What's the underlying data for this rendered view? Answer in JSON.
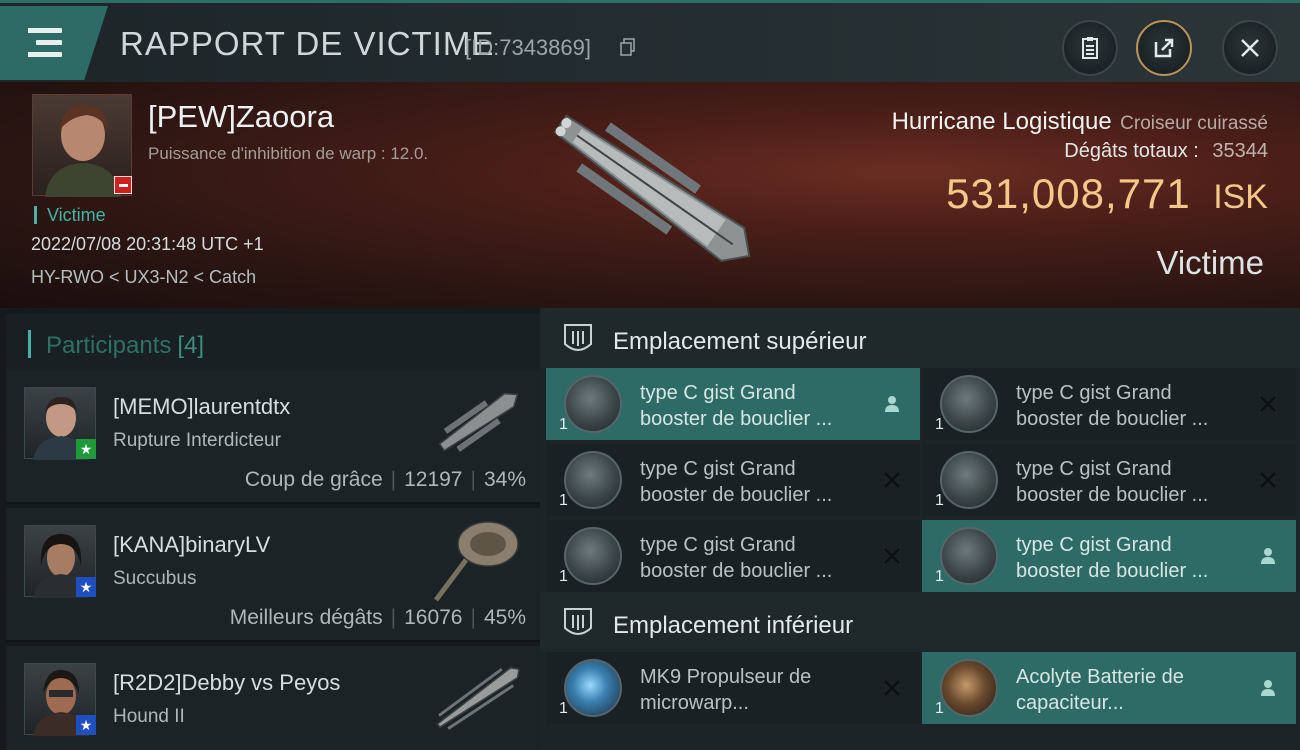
{
  "header": {
    "title": "RAPPORT DE VICTIME",
    "report_id": "[ID:7343869]"
  },
  "victim": {
    "pilot_name": "[PEW]Zaoora",
    "subtitle": "Puissance d'inhibition de warp : 12.0.",
    "tag": "Victime",
    "timestamp": "2022/07/08 20:31:48 UTC +1",
    "location": "HY-RWO < UX3-N2 < Catch",
    "ship_name": "Hurricane Logistique",
    "ship_class": "Croiseur cuirassé",
    "damage_label": "Dégâts totaux :",
    "damage_value": "35344",
    "isk_value": "531,008,771",
    "isk_unit": "ISK",
    "status_label": "Victime"
  },
  "participants": {
    "title": "Participants",
    "count": "[4]",
    "items": [
      {
        "name": "[MEMO]laurentdtx",
        "ship": "Rupture Interdicteur",
        "role": "Coup de grâce",
        "damage": "12197",
        "percent": "34%",
        "badge_color": "#1f9a3a",
        "badge_icon": "star-icon"
      },
      {
        "name": "[KANA]binaryLV",
        "ship": "Succubus",
        "role": "Meilleurs dégâts",
        "damage": "16076",
        "percent": "45%",
        "badge_color": "#1f4fbf",
        "badge_icon": "star-icon"
      },
      {
        "name": "[R2D2]Debby vs Peyos",
        "ship": "Hound II",
        "badge_color": "#1f4fbf",
        "badge_icon": "star-icon"
      }
    ]
  },
  "fittings": {
    "high_slot_title": "Emplacement supérieur",
    "low_slot_title": "Emplacement inférieur",
    "high": [
      {
        "qty": "1",
        "name": "type C gist Grand booster de bouclier ...",
        "status": "person-icon",
        "active": true
      },
      {
        "qty": "1",
        "name": "type C gist Grand booster de bouclier ...",
        "status": "close-icon",
        "active": false
      },
      {
        "qty": "1",
        "name": "type C gist Grand booster de bouclier ...",
        "status": "close-icon",
        "active": false
      },
      {
        "qty": "1",
        "name": "type C gist Grand booster de bouclier ...",
        "status": "close-icon",
        "active": false
      },
      {
        "qty": "1",
        "name": "type C gist Grand booster de bouclier ...",
        "status": "close-icon",
        "active": false
      },
      {
        "qty": "1",
        "name": "type C gist Grand booster de bouclier ...",
        "status": "person-icon",
        "active": true
      }
    ],
    "low": [
      {
        "qty": "1",
        "name": "MK9 Propulseur de microwarp...",
        "status": "close-icon",
        "active": false
      },
      {
        "qty": "1",
        "name": "Acolyte Batterie de capaciteur...",
        "status": "person-icon",
        "active": true
      }
    ]
  },
  "colors": {
    "accent": "#2f6b66",
    "isk": "#f3c889",
    "victim_tag": "#43b4a6",
    "danger": "#d21e1e"
  }
}
